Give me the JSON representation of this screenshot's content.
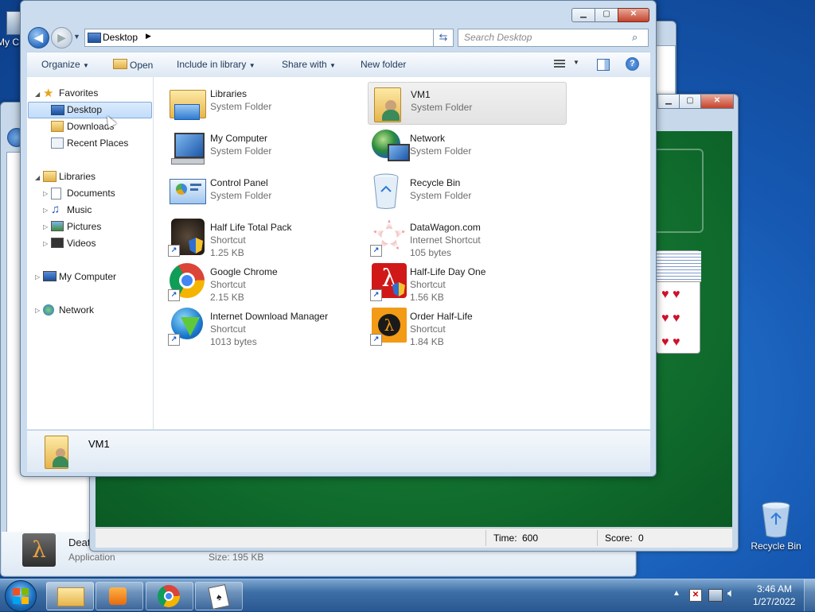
{
  "desktop": {
    "top_left_label": "My C",
    "recycle_bin_label": "Recycle Bin"
  },
  "background_window": {
    "item_name": "Deat",
    "item_type": "Application",
    "item_size": "Size: 195 KB"
  },
  "solitaire": {
    "time_label": "Time:",
    "time_value": "600",
    "score_label": "Score:",
    "score_value": "0"
  },
  "explorer": {
    "address": "Desktop",
    "search_placeholder": "Search Desktop",
    "commands": {
      "organize": "Organize",
      "open": "Open",
      "include_in_library": "Include in library",
      "share_with": "Share with",
      "new_folder": "New folder"
    },
    "nav": {
      "favorites": "Favorites",
      "desktop": "Desktop",
      "downloads": "Downloads",
      "recent_places": "Recent Places",
      "libraries": "Libraries",
      "documents": "Documents",
      "music": "Music",
      "pictures": "Pictures",
      "videos": "Videos",
      "my_computer": "My Computer",
      "network": "Network"
    },
    "items": [
      {
        "name": "Libraries",
        "type": "System Folder",
        "size": ""
      },
      {
        "name": "VM1",
        "type": "System Folder",
        "size": ""
      },
      {
        "name": "My Computer",
        "type": "System Folder",
        "size": ""
      },
      {
        "name": "Network",
        "type": "System Folder",
        "size": ""
      },
      {
        "name": "Control Panel",
        "type": "System Folder",
        "size": ""
      },
      {
        "name": "Recycle Bin",
        "type": "System Folder",
        "size": ""
      },
      {
        "name": "Half Life Total Pack",
        "type": "Shortcut",
        "size": "1.25 KB"
      },
      {
        "name": "DataWagon.com",
        "type": "Internet Shortcut",
        "size": "105 bytes"
      },
      {
        "name": "Google Chrome",
        "type": "Shortcut",
        "size": "2.15 KB"
      },
      {
        "name": "Half-Life Day One",
        "type": "Shortcut",
        "size": "1.56 KB"
      },
      {
        "name": "Internet Download Manager",
        "type": "Shortcut",
        "size": "1013 bytes"
      },
      {
        "name": "Order Half-Life",
        "type": "Shortcut",
        "size": "1.84 KB"
      }
    ],
    "details_name": "VM1"
  },
  "taskbar": {
    "time": "3:46 AM",
    "date": "1/27/2022"
  }
}
